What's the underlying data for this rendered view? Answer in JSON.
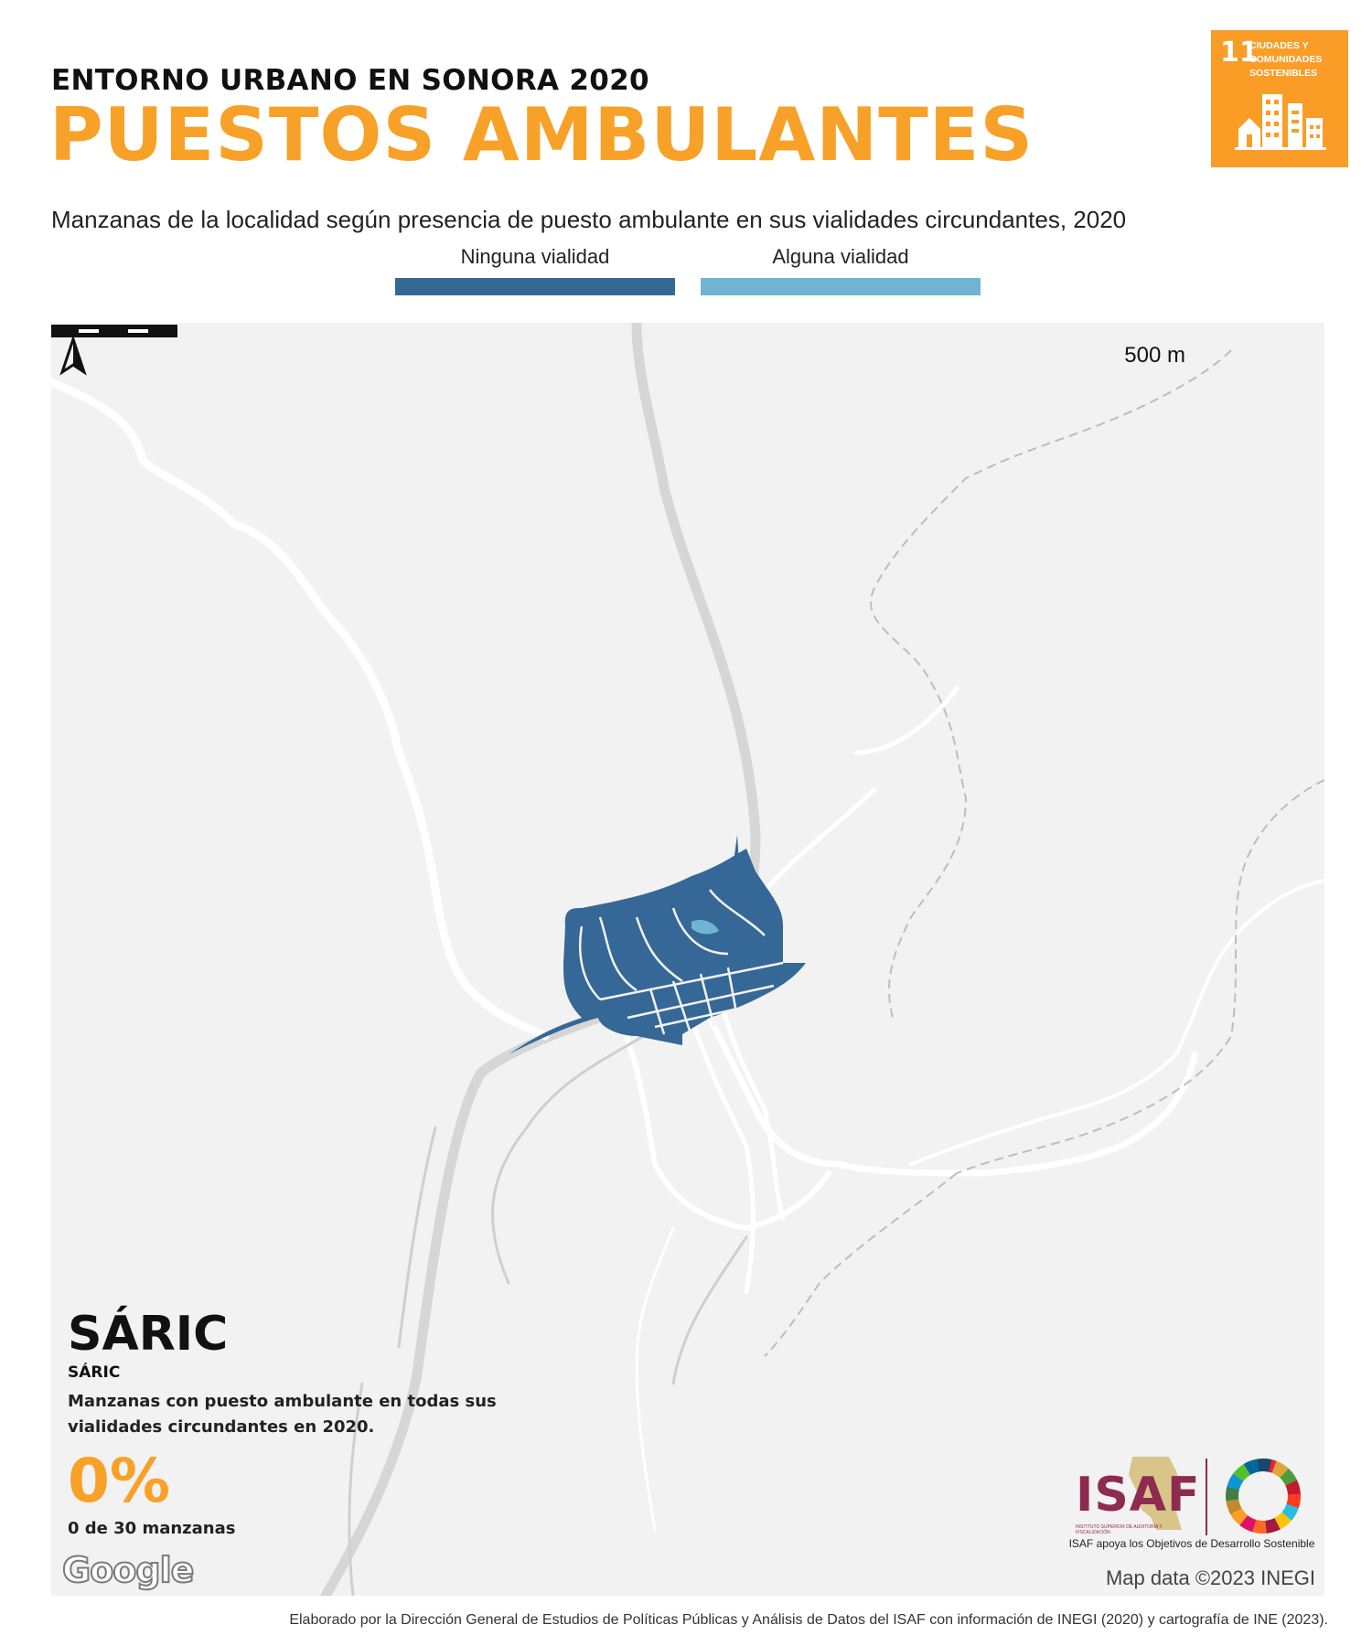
{
  "header": {
    "kicker": "ENTORNO URBANO EN SONORA 2020",
    "title": "PUESTOS AMBULANTES",
    "subtitle": "Manzanas de la localidad según presencia de puesto ambulante en sus vialidades circundantes, 2020"
  },
  "legend": {
    "items": [
      {
        "label": "Ninguna vialidad",
        "color": "#356896"
      },
      {
        "label": "Alguna vialidad",
        "color": "#6fb5d3"
      }
    ]
  },
  "sdg_badge": {
    "number": "11",
    "text_lines": [
      "CIUDADES Y",
      "COMUNIDADES",
      "SOSTENIBLES"
    ],
    "color": "#f99d26",
    "icon": "city-buildings-icon"
  },
  "map": {
    "scale_label": "500 m",
    "north_label": "N",
    "attribution": "Map data ©2023 INEGI",
    "google_logo": "Google",
    "colors": {
      "background": "#f2f2f2",
      "roads": "#ffffff",
      "highway": "#d6d6d6",
      "blocks_none": "#356896",
      "blocks_some": "#6fb5d3"
    }
  },
  "summary": {
    "place": "SÁRIC",
    "municipality": "SÁRIC",
    "description": "Manzanas con puesto ambulante en todas sus vialidades circundantes en 2020.",
    "percent": "0%",
    "count": "0 de 30 manzanas"
  },
  "branding": {
    "isaf": "ISAF",
    "isaf_small": "INSTITUTO SUPERIOR DE AUDITORÍA Y FISCALIZACIÓN",
    "caption": "ISAF apoya los Objetivos de Desarrollo Sostenible"
  },
  "footer": "Elaborado por la Dirección General de Estudios de Políticas Públicas y Análisis de Datos del ISAF con información de INEGI (2020) y cartografía de INE (2023)."
}
